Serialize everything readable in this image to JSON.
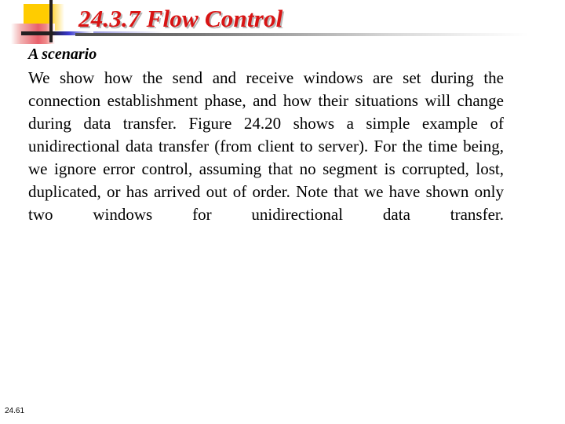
{
  "slide": {
    "title": "24.3.7  Flow Control",
    "heading": "A scenario",
    "paragraph": "We show how the send and receive windows are set during the connection establishment phase, and how their situations will change during data transfer. Figure 24.20 shows a simple example of unidirectional data transfer (from client to server). For the time being, we ignore error control, assuming that no segment is corrupted, lost, duplicated, or has arrived out of order. Note that we have shown only two windows for unidirectional data transfer.",
    "page_number": "24.61",
    "colors": {
      "title_red": "#d81414",
      "title_shadow_gray": "#b8b8b8",
      "deco_yellow": "#ffcc00",
      "deco_pink": "#e8606b",
      "deco_blue": "#3a3ad0",
      "deco_dark": "#231f20",
      "rule_gray": "#4d4d4d",
      "body_black": "#000000",
      "background": "#ffffff"
    }
  }
}
